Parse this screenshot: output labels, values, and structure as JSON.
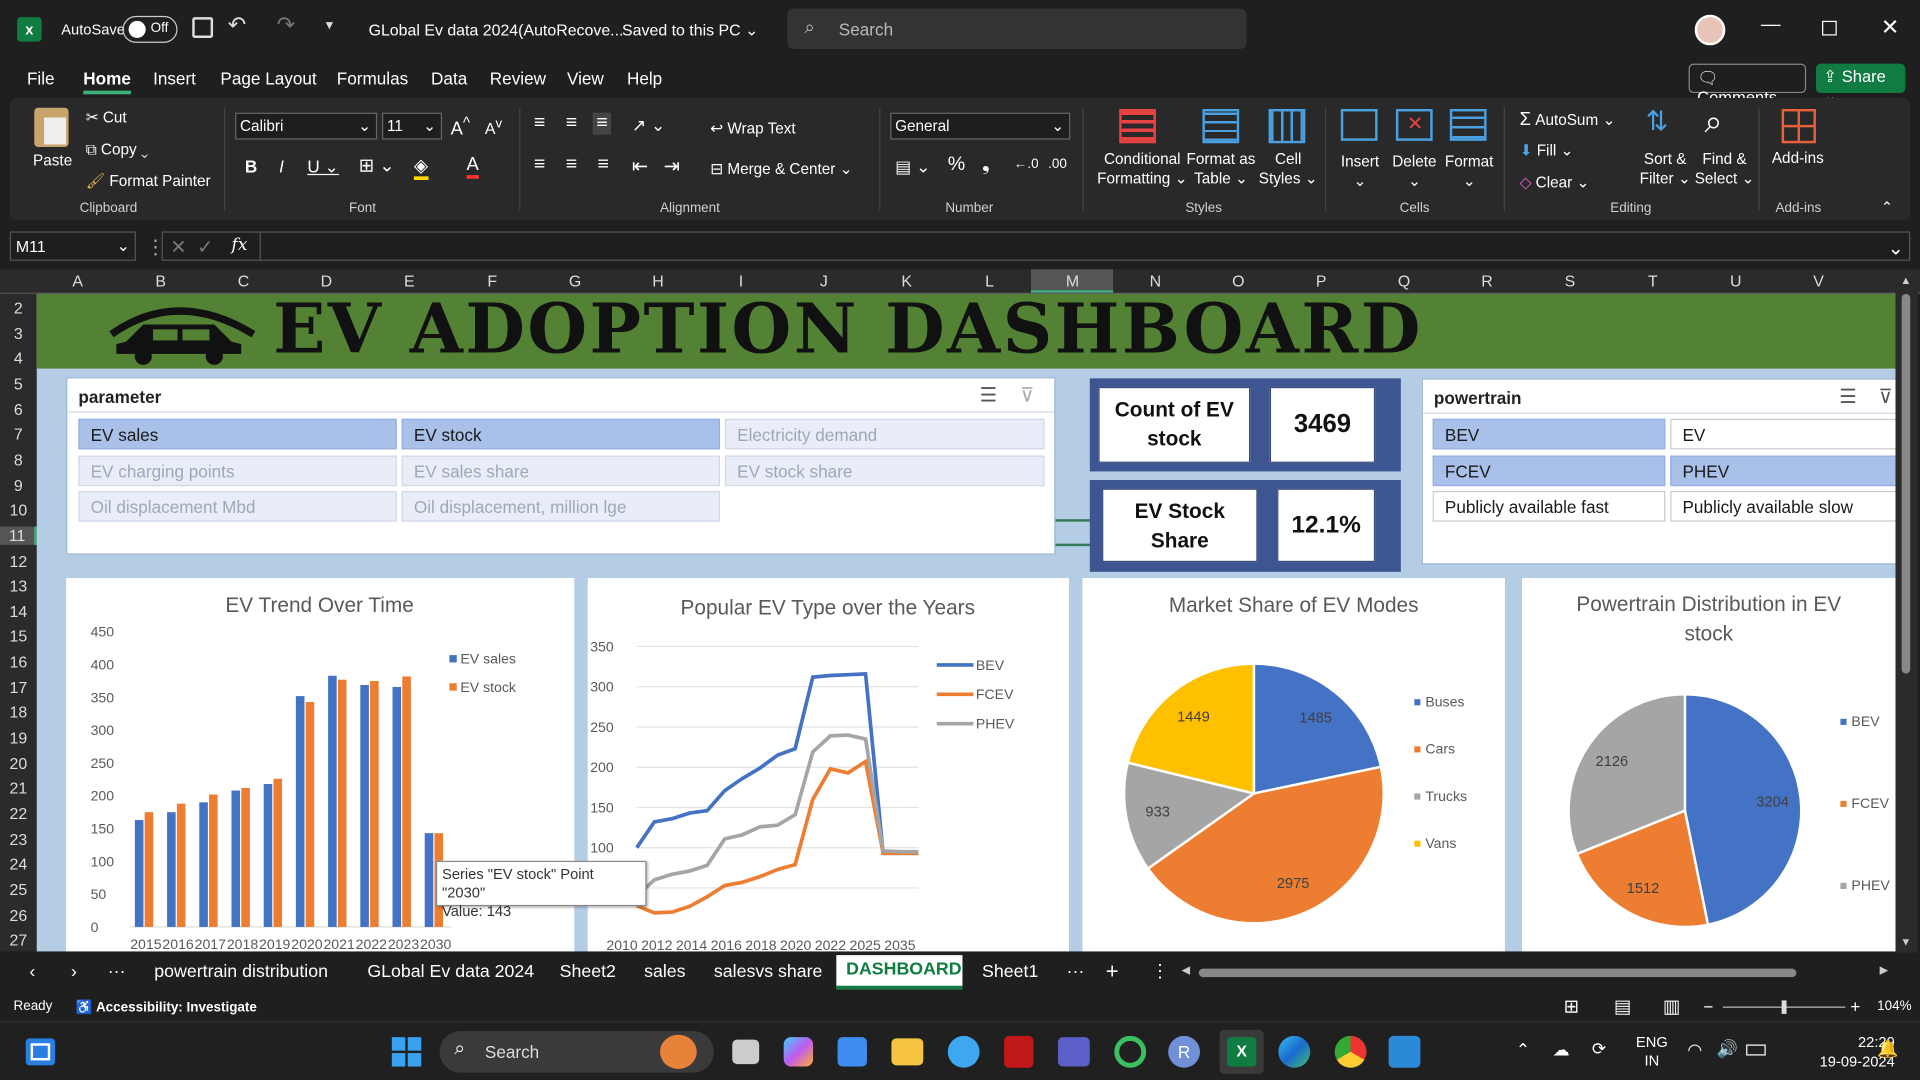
{
  "titlebar": {
    "autosave": "AutoSave",
    "toggle": "Off",
    "doc_title": "GLobal Ev data 2024(AutoRecove...",
    "saved": "Saved to this PC",
    "search": "Search"
  },
  "menu": [
    "File",
    "Home",
    "Insert",
    "Page Layout",
    "Formulas",
    "Data",
    "Review",
    "View",
    "Help"
  ],
  "menu_right": {
    "comments": "Comments",
    "share": "Share"
  },
  "ribbon": {
    "paste": "Paste",
    "cut": "Cut",
    "copy": "Copy",
    "format_painter": "Format Painter",
    "font_name": "Calibri",
    "font_size": "11",
    "wrap_text": "Wrap Text",
    "merge_center": "Merge & Center",
    "number_format": "General",
    "conditional": "Conditional",
    "formatting": "Formatting",
    "format_as": "Format as",
    "table": "Table",
    "cell": "Cell",
    "styles": "Styles",
    "insert": "Insert",
    "delete": "Delete",
    "format": "Format",
    "autosum": "AutoSum",
    "fill": "Fill",
    "clear": "Clear",
    "sort": "Sort &",
    "filter": "Filter",
    "find": "Find &",
    "select": "Select",
    "addins": "Add-ins",
    "groups": [
      "Clipboard",
      "Font",
      "Alignment",
      "Number",
      "Styles",
      "Cells",
      "Editing",
      "Add-ins"
    ]
  },
  "formula_bar": {
    "name_box": "M11",
    "fx": "fx"
  },
  "columns": [
    "A",
    "B",
    "C",
    "D",
    "E",
    "F",
    "G",
    "H",
    "I",
    "J",
    "K",
    "L",
    "M",
    "N",
    "O",
    "P",
    "Q",
    "R",
    "S",
    "T",
    "U",
    "V"
  ],
  "rows": [
    "2",
    "3",
    "4",
    "5",
    "6",
    "7",
    "8",
    "9",
    "10",
    "11",
    "12",
    "13",
    "14",
    "15",
    "16",
    "17",
    "18",
    "19",
    "20",
    "21",
    "22",
    "23",
    "24",
    "25",
    "26",
    "27"
  ],
  "dashboard": {
    "title": "EV ADOPTION DASHBOARD",
    "parameter_slicer": {
      "header": "parameter",
      "items": [
        "EV sales",
        "EV stock",
        "Electricity demand",
        "EV charging points",
        "EV sales share",
        "EV stock share",
        "Oil displacement Mbd",
        "Oil displacement, million lge"
      ]
    },
    "kpi1": {
      "label": "Count of EV stock",
      "value": "3469"
    },
    "kpi2": {
      "label": "EV Stock Share",
      "value": "12.1%"
    },
    "powertrain_slicer": {
      "header": "powertrain",
      "items": [
        "BEV",
        "EV",
        "FCEV",
        "PHEV",
        "Publicly available fast",
        "Publicly available slow"
      ]
    },
    "tooltip": {
      "line1": "Series \"EV stock\" Point \"2030\"",
      "line2": "Value: 143"
    }
  },
  "chart_data": [
    {
      "type": "bar",
      "title": "EV Trend Over Time",
      "categories": [
        "2015",
        "2016",
        "2017",
        "2018",
        "2019",
        "2020",
        "2021",
        "2022",
        "2023",
        "2030"
      ],
      "series": [
        {
          "name": "EV sales",
          "values": [
            163,
            175,
            190,
            208,
            218,
            352,
            383,
            369,
            366,
            143
          ]
        },
        {
          "name": "EV stock",
          "values": [
            175,
            188,
            202,
            212,
            226,
            343,
            377,
            375,
            382,
            143
          ]
        }
      ],
      "ylim": [
        0,
        450
      ],
      "yticks": [
        0,
        50,
        100,
        150,
        200,
        250,
        300,
        350,
        400,
        450
      ],
      "colors": [
        "#4472C4",
        "#ED7D31"
      ],
      "legend": "top-right"
    },
    {
      "type": "line",
      "title": "Popular EV Type over the Years",
      "x": [
        "2010",
        "2011",
        "2012",
        "2013",
        "2014",
        "2015",
        "2016",
        "2017",
        "2018",
        "2019",
        "2020",
        "2021",
        "2022",
        "2023",
        "2025",
        "2030",
        "2035"
      ],
      "xticks": [
        "2010",
        "2012",
        "2014",
        "2016",
        "2018",
        "2020",
        "2022",
        "2025",
        "2035"
      ],
      "series": [
        {
          "name": "BEV",
          "values": [
            100,
            132,
            136,
            143,
            146,
            171,
            186,
            199,
            215,
            223,
            312,
            314,
            315,
            316,
            93,
            93,
            93
          ]
        },
        {
          "name": "FCEV",
          "values": [
            28,
            19,
            20,
            27,
            39,
            53,
            57,
            64,
            73,
            79,
            160,
            198,
            193,
            207,
            93,
            93,
            93
          ]
        },
        {
          "name": "PHEV",
          "values": [
            40,
            60,
            67,
            71,
            78,
            111,
            116,
            126,
            128,
            141,
            219,
            239,
            240,
            235,
            96,
            95,
            95
          ]
        }
      ],
      "ylim": [
        0,
        350
      ],
      "yticks": [
        50,
        100,
        150,
        200,
        250,
        300,
        350
      ],
      "colors": [
        "#4472C4",
        "#ED7D31",
        "#A5A5A5"
      ],
      "legend": "right"
    },
    {
      "type": "pie",
      "title": "Market Share of EV Modes",
      "categories": [
        "Buses",
        "Cars",
        "Trucks",
        "Vans"
      ],
      "values": [
        1485,
        2975,
        933,
        1449
      ],
      "colors": [
        "#4472C4",
        "#ED7D31",
        "#A5A5A5",
        "#FFC000"
      ],
      "legend": "right"
    },
    {
      "type": "pie",
      "title": "Powertrain Distribution in EV stock",
      "categories": [
        "BEV",
        "FCEV",
        "PHEV"
      ],
      "values": [
        3204,
        1512,
        2126
      ],
      "colors": [
        "#4472C4",
        "#ED7D31",
        "#A5A5A5"
      ],
      "legend": "right"
    }
  ],
  "sheet_tabs": [
    "powertrain distribution",
    "GLobal Ev data 2024",
    "Sheet2",
    "sales",
    "salesvs share",
    "DASHBOARD",
    "Sheet1"
  ],
  "active_tab": "DASHBOARD",
  "status": {
    "ready": "Ready",
    "accessibility": "Accessibility: Investigate",
    "zoom": "104%"
  },
  "taskbar": {
    "search": "Search",
    "lang1": "ENG",
    "lang2": "IN",
    "time": "22:29",
    "date": "19-09-2024"
  }
}
